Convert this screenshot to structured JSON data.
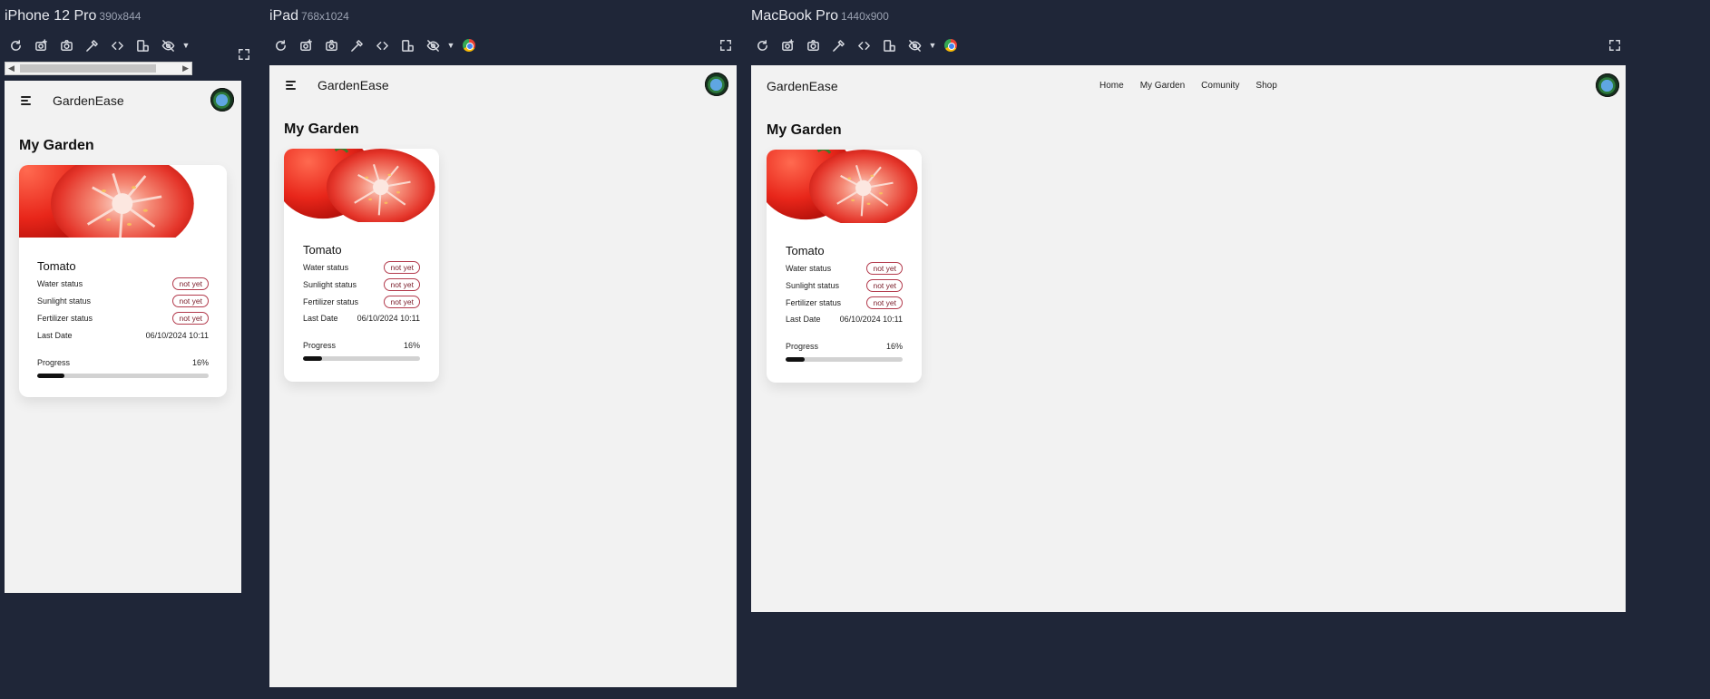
{
  "devices": [
    {
      "name": "iPhone 12 Pro",
      "dims": "390x844"
    },
    {
      "name": "iPad",
      "dims": "768x1024"
    },
    {
      "name": "MacBook Pro",
      "dims": "1440x900"
    }
  ],
  "toolbar_icons": [
    "refresh-icon",
    "screenshot-icon",
    "camera-icon",
    "eyedropper-icon",
    "code-icon",
    "rotate-icon",
    "hide-icon"
  ],
  "app": {
    "brand": "GardenEase",
    "nav": [
      "Home",
      "My Garden",
      "Comunity",
      "Shop"
    ],
    "page_title": "My Garden",
    "plant": {
      "name": "Tomato",
      "water_label": "Water status",
      "water_value": "not yet",
      "sun_label": "Sunlight status",
      "sun_value": "not yet",
      "fert_label": "Fertilizer status",
      "fert_value": "not yet",
      "date_label": "Last Date",
      "date_value": "06/10/2024 10:11",
      "progress_label": "Progress",
      "progress_text": "16%",
      "progress": 0.16
    }
  },
  "colors": {
    "background": "#1f2638",
    "viewport": "#f2f2f2",
    "badge": "#b33a4c"
  }
}
